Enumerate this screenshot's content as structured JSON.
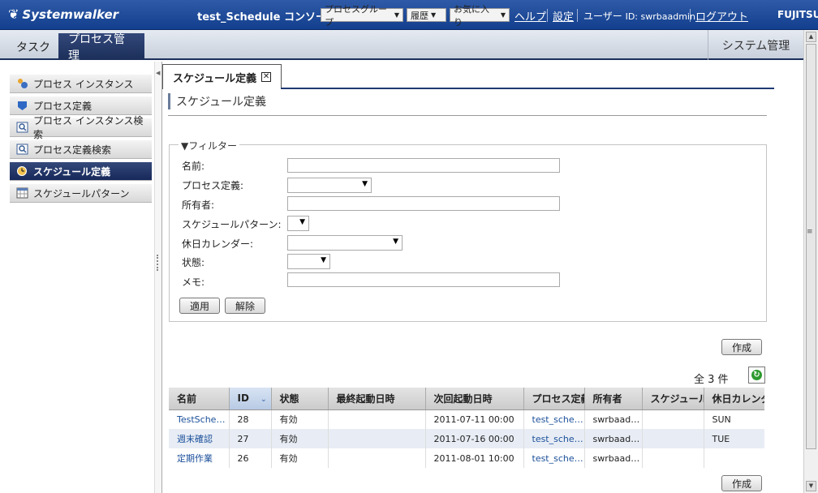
{
  "header": {
    "logo": "Systemwalker",
    "console_title": "test_Schedule コンソール",
    "process_group": "プロセスグループ",
    "history": "履歴",
    "favorites": "お気に入り",
    "help": "ヘルプ",
    "settings": "設定",
    "user_label": "ユーザー",
    "user_id": "ID: swrbaadmin",
    "logout": "ログアウト",
    "brand": "FUJITSU"
  },
  "nav": {
    "tab_task": "タスク",
    "tab_process": "プロセス管理",
    "tab_system": "システム管理"
  },
  "sidebar": {
    "items": [
      {
        "label": "プロセス インスタンス",
        "icon": "process-instance-icon"
      },
      {
        "label": "プロセス定義",
        "icon": "process-definition-icon"
      },
      {
        "label": "プロセス インスタンス検索",
        "icon": "search-icon"
      },
      {
        "label": "プロセス定義検索",
        "icon": "search-icon"
      },
      {
        "label": "スケジュール定義",
        "icon": "schedule-icon"
      },
      {
        "label": "スケジュールパターン",
        "icon": "calendar-icon"
      }
    ]
  },
  "content": {
    "tab_label": "スケジュール定義",
    "page_title": "スケジュール定義"
  },
  "filter": {
    "legend": "▼フィルター",
    "name_label": "名前:",
    "process_def_label": "プロセス定義:",
    "owner_label": "所有者:",
    "pattern_label": "スケジュールパターン:",
    "holiday_label": "休日カレンダー:",
    "status_label": "状態:",
    "memo_label": "メモ:",
    "apply_button": "適用",
    "clear_button": "解除"
  },
  "actions": {
    "create_button": "作成",
    "count": "全 3 件"
  },
  "table": {
    "columns": [
      "名前",
      "ID",
      "状態",
      "最終起動日時",
      "次回起動日時",
      "プロセス定義",
      "所有者",
      "スケジュールパターン",
      "休日カレンダー"
    ],
    "rows": [
      [
        "TestSchedule",
        "28",
        "有効",
        "",
        "2011-07-11 00:00",
        "test_schedule",
        "swrbaadmin",
        "",
        "SUN"
      ],
      [
        "週末確認",
        "27",
        "有効",
        "",
        "2011-07-16 00:00",
        "test_schedule",
        "swrbaadmin",
        "",
        "TUE"
      ],
      [
        "定期作業",
        "26",
        "有効",
        "",
        "2011-08-01 10:00",
        "test_schedule",
        "swrbaadmin",
        "",
        ""
      ]
    ]
  },
  "colors": {
    "header_blue": "#1a4594",
    "nav_active": "#1c2f5a",
    "link": "#1a4f9a"
  }
}
